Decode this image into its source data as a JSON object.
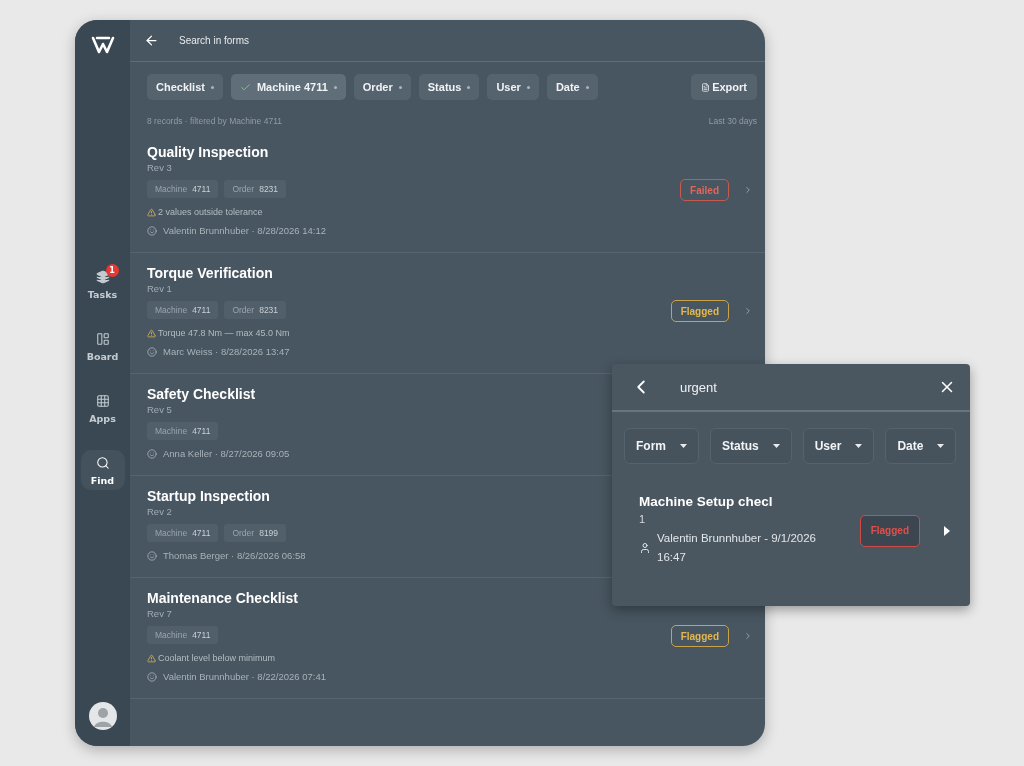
{
  "sidebar": {
    "items": [
      {
        "kind": "layers",
        "label": "Tasks",
        "selected": false,
        "badge": "1"
      },
      {
        "kind": "board",
        "label": "Board",
        "selected": false
      },
      {
        "kind": "grid",
        "label": "Apps",
        "selected": false
      },
      {
        "kind": "search",
        "label": "Find",
        "selected": true
      }
    ]
  },
  "header": {
    "title": "Search in forms"
  },
  "filters": [
    {
      "label": "Checklist",
      "selected": false
    },
    {
      "label": "Machine",
      "value": "4711",
      "selected": true
    },
    {
      "label": "Order",
      "selected": false
    },
    {
      "label": "Status",
      "selected": false
    },
    {
      "label": "User",
      "selected": false
    },
    {
      "label": "Date",
      "selected": false
    }
  ],
  "export_button": "Export",
  "summary": "8 records · filtered by Machine 4711",
  "range": "Last 30 days",
  "records": [
    {
      "title": "Quality Inspection",
      "rev": "Rev 3",
      "tags": [
        {
          "label": "Machine",
          "value": "4711"
        },
        {
          "label": "Order",
          "value": "8231"
        }
      ],
      "warning": "2 values outside tolerance",
      "meta": "Valentin Brunnhuber · 8/28/2026 14:12",
      "status": {
        "kind": "failed",
        "label": "Failed"
      }
    },
    {
      "title": "Torque Verification",
      "rev": "Rev 1",
      "tags": [
        {
          "label": "Machine",
          "value": "4711"
        },
        {
          "label": "Order",
          "value": "8231"
        }
      ],
      "warning": "Torque 47.8 Nm — max 45.0 Nm",
      "meta": "Marc Weiss · 8/28/2026 13:47",
      "status": {
        "kind": "flagged",
        "label": "Flagged"
      }
    },
    {
      "title": "Safety Checklist",
      "rev": "Rev 5",
      "tags": [
        {
          "label": "Machine",
          "value": "4711"
        }
      ],
      "meta": "Anna Keller · 8/27/2026 09:05"
    },
    {
      "title": "Startup Inspection",
      "rev": "Rev 2",
      "tags": [
        {
          "label": "Machine",
          "value": "4711"
        },
        {
          "label": "Order",
          "value": "8199"
        }
      ],
      "meta": "Thomas Berger · 8/26/2026 06:58"
    },
    {
      "title": "Maintenance Checklist",
      "rev": "Rev 7",
      "tags": [
        {
          "label": "Machine",
          "value": "4711"
        }
      ],
      "warning": "Coolant level below minimum",
      "meta": "Valentin Brunnhuber · 8/22/2026 07:41",
      "status": {
        "kind": "flagged",
        "label": "Flagged"
      }
    }
  ],
  "search_popup": {
    "query": "urgent",
    "filters": [
      "Form",
      "Status",
      "User",
      "Date"
    ],
    "result": {
      "title": "Machine Setup checl",
      "rev": "1",
      "meta": "Valentin Brunnhuber - 9/1/2026 16:47",
      "status": {
        "kind": "alert",
        "label": "Flagged"
      }
    }
  }
}
